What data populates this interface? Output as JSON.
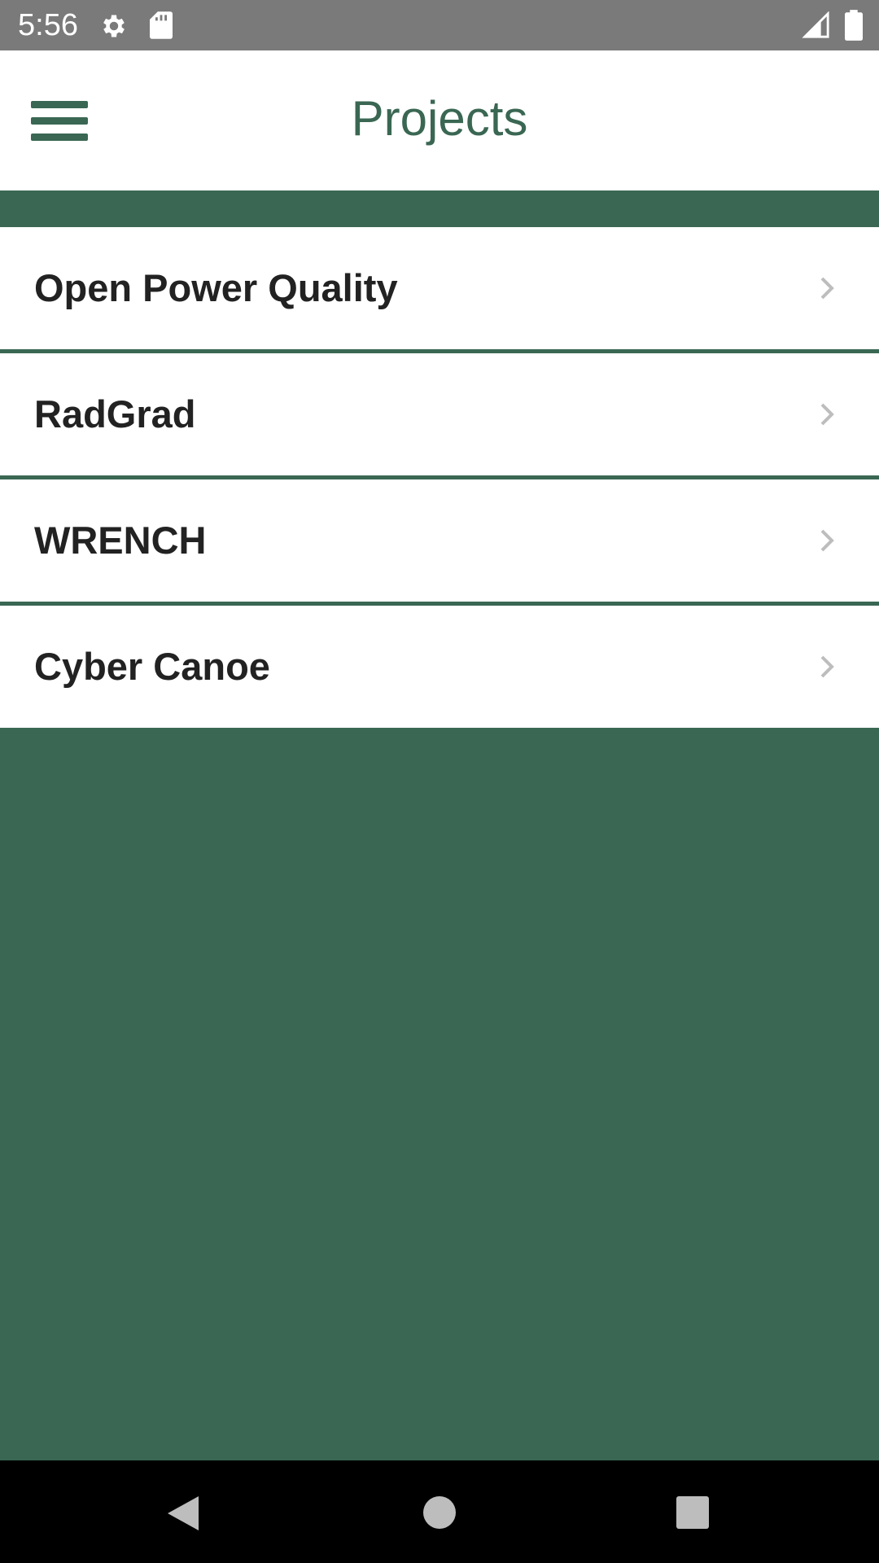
{
  "status_bar": {
    "time": "5:56",
    "icons": [
      "settings-icon",
      "sd-card-icon",
      "signal-icon",
      "battery-icon"
    ]
  },
  "app_bar": {
    "title": "Projects",
    "menu_icon": "hamburger-menu-icon"
  },
  "projects": [
    {
      "label": "Open Power Quality",
      "icon": "chevron-right-icon"
    },
    {
      "label": "RadGrad",
      "icon": "chevron-right-icon"
    },
    {
      "label": "WRENCH",
      "icon": "chevron-right-icon"
    },
    {
      "label": "Cyber Canoe",
      "icon": "chevron-right-icon"
    }
  ],
  "nav_bar": {
    "icons": [
      "back-icon",
      "home-icon",
      "recents-icon"
    ]
  },
  "colors": {
    "accent": "#3a6753",
    "status_bar": "#7a7a7a",
    "text": "#222222",
    "chevron": "#bdbdbd"
  }
}
